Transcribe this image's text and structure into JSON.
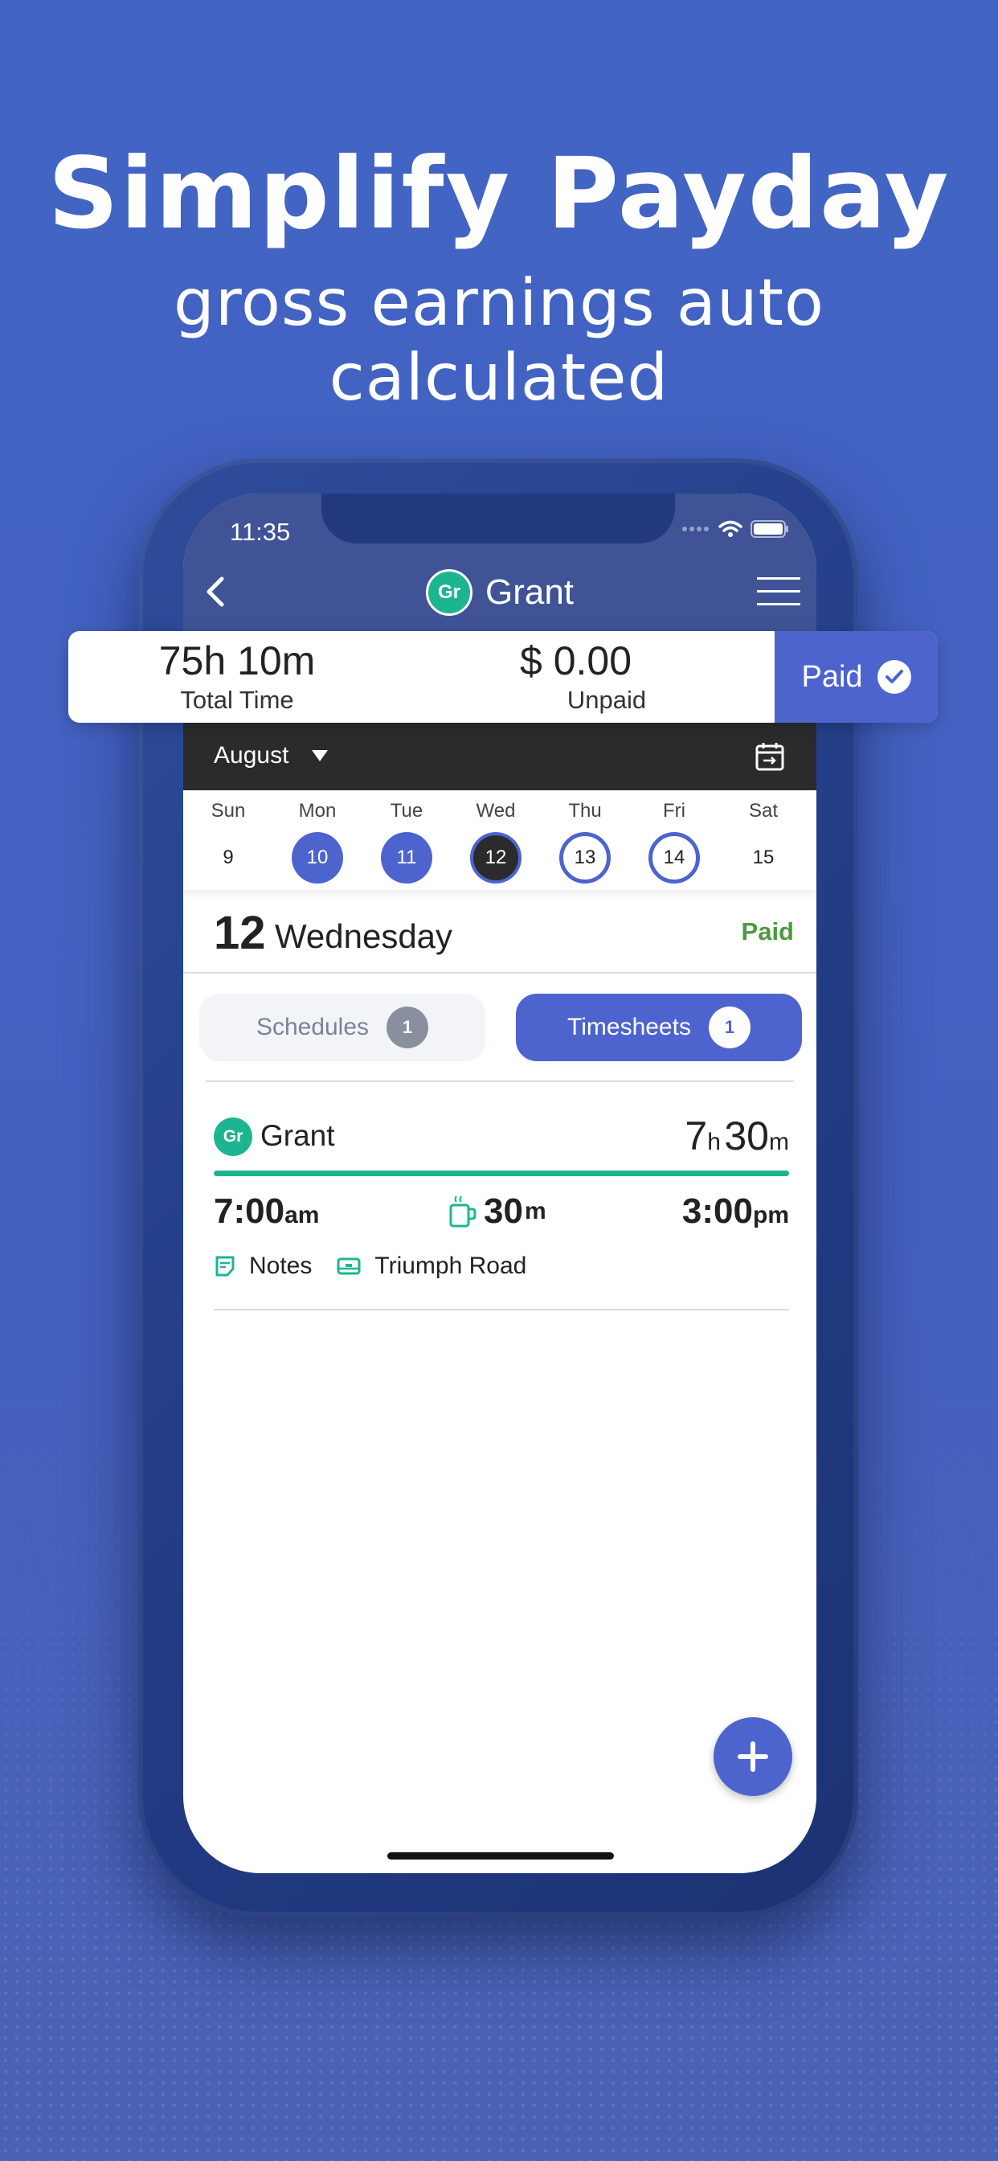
{
  "promo": {
    "headline": "Simplify Payday",
    "subline": "gross earnings auto calculated"
  },
  "status_bar": {
    "time": "11:35"
  },
  "header": {
    "avatar_initials": "Gr",
    "title": "Grant",
    "icons": [
      "chevron-left-icon",
      "hamburger-menu-icon"
    ]
  },
  "summary": {
    "total_time_value": "75h 10m",
    "total_time_label": "Total Time",
    "amount_value": "$ 0.00",
    "amount_label": "Unpaid",
    "paid_button_label": "Paid"
  },
  "calendar": {
    "month": "August",
    "days": [
      {
        "name": "Sun",
        "num": "9",
        "state": "plain"
      },
      {
        "name": "Mon",
        "num": "10",
        "state": "filled"
      },
      {
        "name": "Tue",
        "num": "11",
        "state": "filled"
      },
      {
        "name": "Wed",
        "num": "12",
        "state": "selected"
      },
      {
        "name": "Thu",
        "num": "13",
        "state": "ring"
      },
      {
        "name": "Fri",
        "num": "14",
        "state": "ring"
      },
      {
        "name": "Sat",
        "num": "15",
        "state": "plain"
      }
    ]
  },
  "day_header": {
    "day_number": "12",
    "day_name": "Wednesday",
    "status": "Paid"
  },
  "tabs": {
    "schedules_label": "Schedules",
    "schedules_count": "1",
    "timesheets_label": "Timesheets",
    "timesheets_count": "1"
  },
  "entry": {
    "avatar_initials": "Gr",
    "name": "Grant",
    "duration_hours": "7",
    "duration_h_unit": "h",
    "duration_minutes": "30",
    "duration_m_unit": "m",
    "start_time": "7:00",
    "start_suffix": "am",
    "break_value": "30",
    "break_unit": "m",
    "end_time": "3:00",
    "end_suffix": "pm",
    "notes_label": "Notes",
    "location": "Triumph Road"
  },
  "colors": {
    "accent": "#4d64cf",
    "avatar_green": "#1db591",
    "paid_green": "#4b9b3c",
    "nav_bg": "#3f5396",
    "month_bar_bg": "#2b2b2d"
  }
}
